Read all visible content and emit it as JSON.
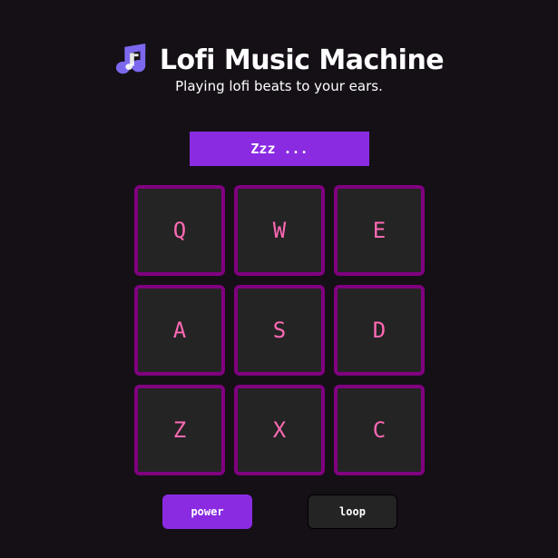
{
  "header": {
    "title": "Lofi Music Machine",
    "subtitle": "Playing lofi beats to your ears.",
    "icon": "music-notes-icon"
  },
  "display": {
    "text": "Zzz ..."
  },
  "pads": [
    {
      "key": "Q"
    },
    {
      "key": "W"
    },
    {
      "key": "E"
    },
    {
      "key": "A"
    },
    {
      "key": "S"
    },
    {
      "key": "D"
    },
    {
      "key": "Z"
    },
    {
      "key": "X"
    },
    {
      "key": "C"
    }
  ],
  "controls": {
    "power_label": "power",
    "loop_label": "loop"
  },
  "colors": {
    "background": "#151016",
    "accent": "#8a2be2",
    "pad_border": "#800080",
    "pad_fill": "#242424",
    "pad_text": "#ff69b4",
    "icon": "#7b68ee"
  }
}
